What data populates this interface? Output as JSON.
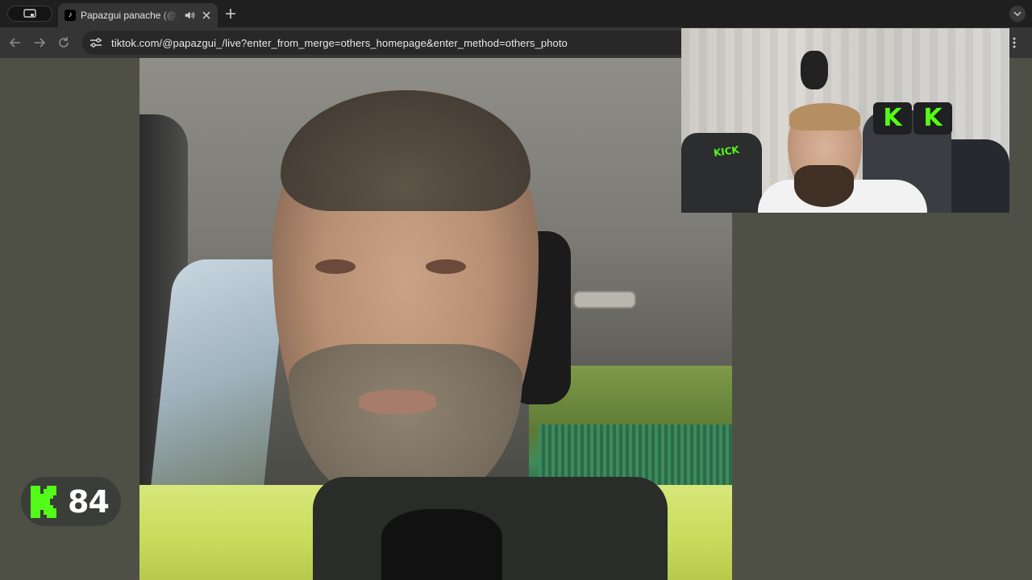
{
  "browser": {
    "tab": {
      "title": "Papazgui panache (@papazgui_) | TikTok"
    },
    "address_bar": {
      "url": "tiktok.com/@papazgui_/live?enter_from_merge=others_homepage&enter_method=others_photo"
    }
  },
  "stream": {
    "kick_badge": {
      "count": "84"
    },
    "webcam": {
      "pillow_letter": "K",
      "shirt_logo": "KICK"
    }
  },
  "colors": {
    "kick_green": "#53fc18",
    "page_background": "#4f5045",
    "tabstrip": "#1f1f1f",
    "toolbar": "#353535"
  },
  "icons": [
    "tab-search-icon",
    "tiktok-favicon",
    "speaker-icon",
    "close-icon",
    "plus-icon",
    "chevron-down-icon",
    "back-arrow-icon",
    "forward-arrow-icon",
    "reload-icon",
    "site-settings-icon",
    "kick-logo-icon"
  ]
}
